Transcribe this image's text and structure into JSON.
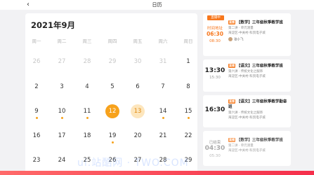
{
  "header": {
    "back_icon": "chevron-left-icon",
    "title": "日历"
  },
  "calendar": {
    "month_label": "2021年9月",
    "weekdays": [
      "周一",
      "周二",
      "周三",
      "周四",
      "周五",
      "周六",
      "周日"
    ],
    "rows": [
      [
        {
          "d": "26",
          "prev": true
        },
        {
          "d": "27",
          "prev": true
        },
        {
          "d": "28",
          "prev": true
        },
        {
          "d": "29",
          "prev": true
        },
        {
          "d": "30",
          "prev": true
        },
        {
          "d": "31",
          "prev": true
        },
        {
          "d": "1"
        }
      ],
      [
        {
          "d": "2"
        },
        {
          "d": "3"
        },
        {
          "d": "4"
        },
        {
          "d": "5"
        },
        {
          "d": "6"
        },
        {
          "d": "7"
        },
        {
          "d": "8"
        }
      ],
      [
        {
          "d": "9",
          "dot": "orange"
        },
        {
          "d": "10",
          "dot": "orange"
        },
        {
          "d": "11",
          "dot": "orange"
        },
        {
          "d": "12",
          "sel": true
        },
        {
          "d": "13",
          "today": true
        },
        {
          "d": "14",
          "dot": "orange"
        },
        {
          "d": "15",
          "dot": "orange"
        }
      ],
      [
        {
          "d": "16"
        },
        {
          "d": "17"
        },
        {
          "d": "18"
        },
        {
          "d": "19",
          "dot": "orange"
        },
        {
          "d": "20"
        },
        {
          "d": "21"
        },
        {
          "d": "22"
        }
      ],
      [
        {
          "d": "23"
        },
        {
          "d": "24"
        },
        {
          "d": "25"
        },
        {
          "d": "26"
        },
        {
          "d": "27"
        },
        {
          "d": "28"
        },
        {
          "d": "29"
        }
      ]
    ]
  },
  "events": [
    {
      "badge": "直播中",
      "status": "时间地址",
      "start": "06:30",
      "end": "08:30",
      "tag": "直播",
      "title": "【数学】三年级秋季教学班",
      "meta1": "第二讲 · 单元测量",
      "meta2": "海淀区-中关村-科贸电子城",
      "teacher": "张小飞"
    },
    {
      "start": "13:30",
      "end": "15:30",
      "tag": "直播",
      "title": "【语文】三年级秋季教学班",
      "meta1": "第六讲 · 传统文化之服饰",
      "meta2": "海淀区-中关村-科贸电子城"
    },
    {
      "start": "16:30",
      "end": "",
      "tag": "直播",
      "title": "【语文】三年级秋季教学勤奋班",
      "meta1": "第六讲 · 传统文化之服饰",
      "meta2": "海淀区-中关村-科贸电子城"
    },
    {
      "status": "已结束",
      "start": "04:30",
      "end": "05:30",
      "tag": "直播",
      "title": "【数学】三年级秋季教学班",
      "meta1": "第二讲 · 单元测量",
      "meta2": "海淀区-中关村-科贸电子城"
    }
  ],
  "watermark": "ui.站酷网 · TWO.COM",
  "colors": {
    "accent": "#f7a21c",
    "today_bg": "#fde6bd",
    "tag": "#f77a1e",
    "bottom_bar": "#f52f4b"
  }
}
